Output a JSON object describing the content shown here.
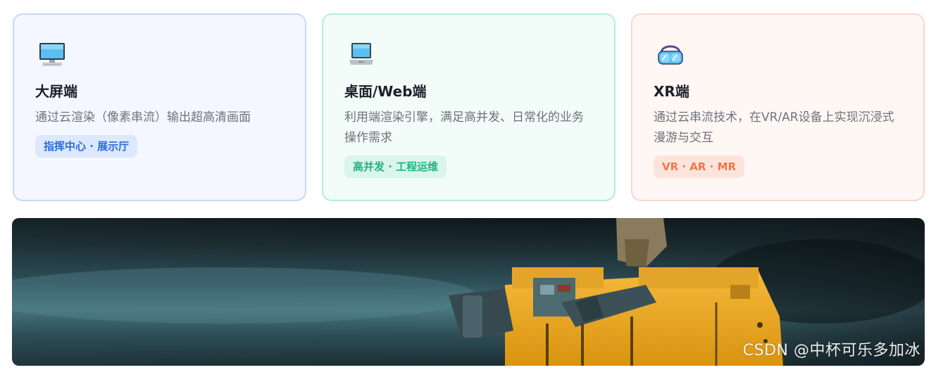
{
  "cards": [
    {
      "icon": "monitor-icon",
      "title": "大屏端",
      "desc": "通过云渲染（像素串流）输出超高清画面",
      "tag": "指挥中心 · 展示厅",
      "accent": "#2a6dd8"
    },
    {
      "icon": "laptop-icon",
      "title": "桌面/Web端",
      "desc": "利用端渲染引擎，满足高并发、日常化的业务操作需求",
      "tag": "高并发 · 工程运维",
      "accent": "#1fb384"
    },
    {
      "icon": "vr-goggles-icon",
      "title": "XR端",
      "desc": "通过云串流技术，在VR/AR设备上实现沉浸式漫游与交互",
      "tag": "VR · AR · MR",
      "accent": "#f07848"
    }
  ],
  "hero": {
    "image": "robot-photo"
  },
  "watermark": "CSDN @中杯可乐多加冰"
}
